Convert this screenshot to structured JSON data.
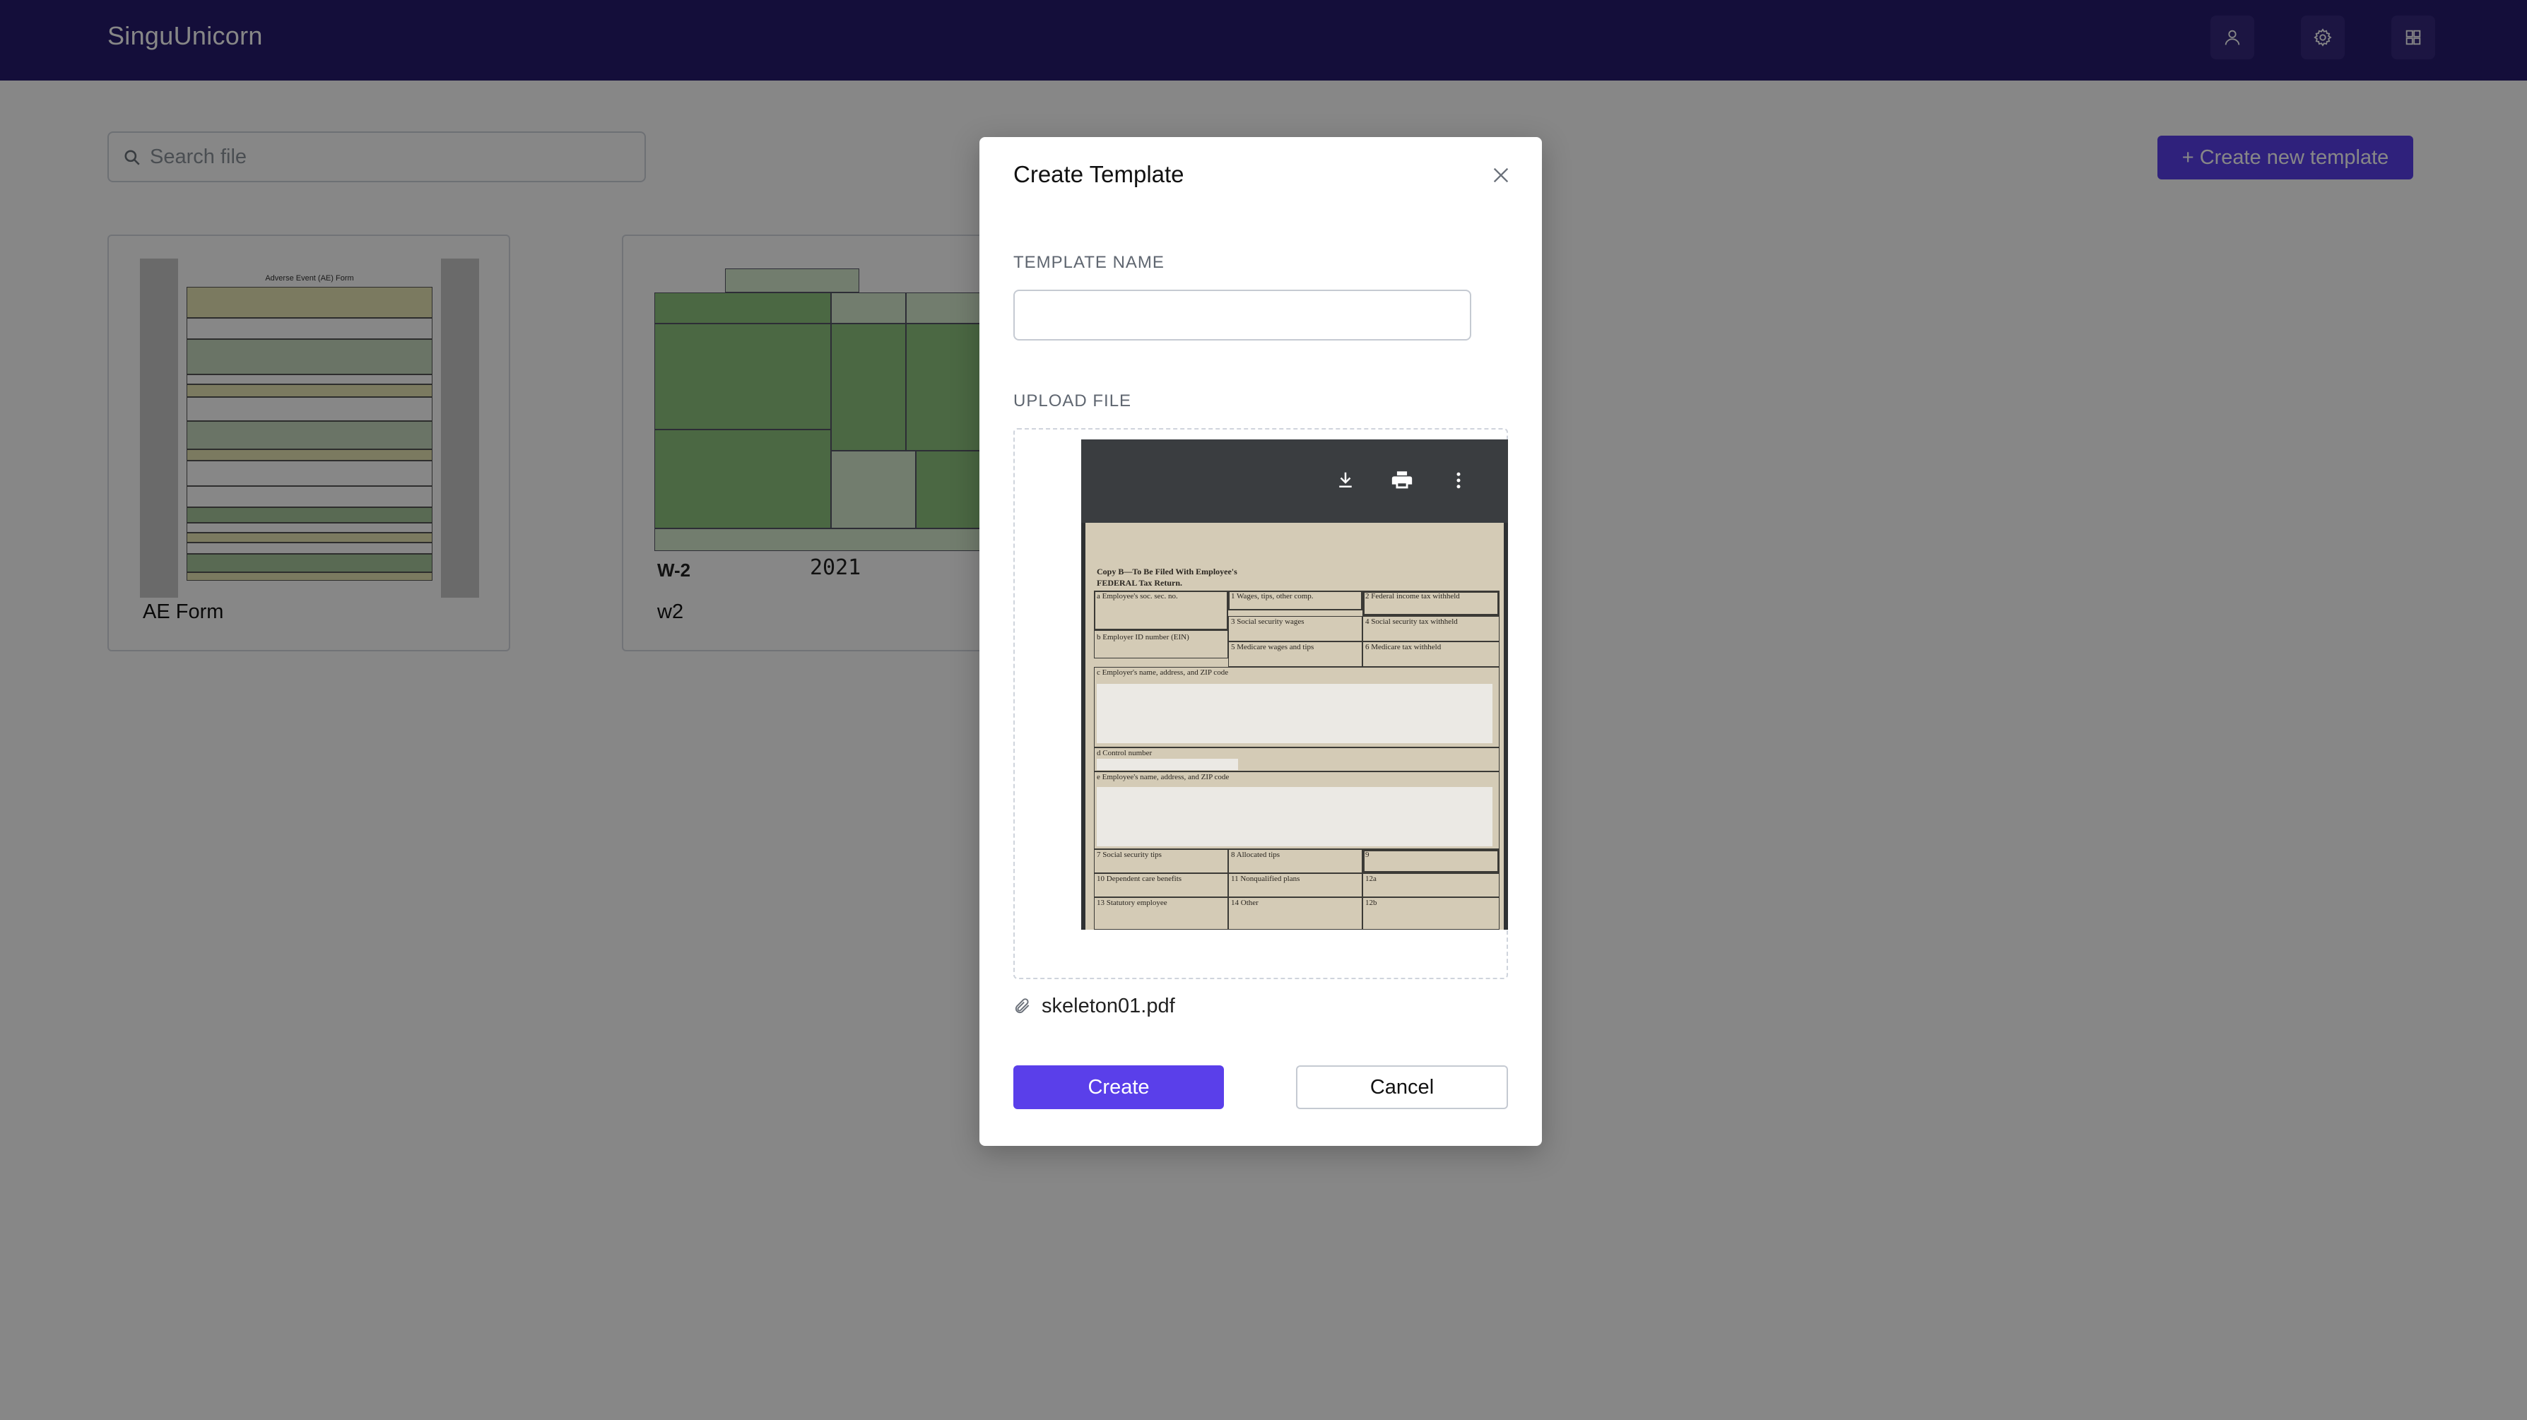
{
  "app": {
    "brand": "SinguUnicorn"
  },
  "header": {
    "icons": [
      "user-icon",
      "gear-icon",
      "grid-icon"
    ]
  },
  "search": {
    "placeholder": "Search file",
    "value": ""
  },
  "actions": {
    "create_new_label": "+ Create new template"
  },
  "templates": [
    {
      "label": "AE Form",
      "thumb_title": "Adverse Event (AE) Form"
    },
    {
      "label": "w2",
      "thumb_form": "W-2",
      "thumb_year": "2021"
    }
  ],
  "modal": {
    "title": "Create Template",
    "template_name_label": "TEMPLATE NAME",
    "template_name_value": "",
    "upload_label": "UPLOAD FILE",
    "file_name": "skeleton01.pdf",
    "create_label": "Create",
    "cancel_label": "Cancel",
    "pdf_toolbar_icons": [
      "download-icon",
      "print-icon",
      "more-vert-icon"
    ],
    "preview": {
      "heading": "Copy B—To Be Filed With Employee's",
      "subheading": "FEDERAL Tax Return.",
      "fields": [
        "a Employee's soc. sec. no.",
        "1 Wages, tips, other comp.",
        "2 Federal income tax withheld",
        "b Employer ID number (EIN)",
        "3 Social security wages",
        "4 Social security tax withheld",
        "5 Medicare wages and tips",
        "6 Medicare tax withheld",
        "c Employer's name, address, and ZIP code",
        "d Control number",
        "e Employee's name, address, and ZIP code",
        "7 Social security tips",
        "8 Allocated tips",
        "9",
        "10 Dependent care benefits",
        "11 Nonqualified plans",
        "12a",
        "13 Statutory employee",
        "14 Other",
        "12b"
      ]
    }
  },
  "colors": {
    "topbar": "#261c6e",
    "primary": "#5a3fea"
  }
}
